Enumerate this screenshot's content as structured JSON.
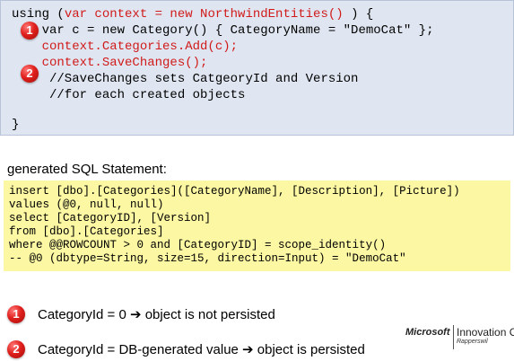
{
  "code": {
    "lines": [
      {
        "parts": [
          "using (",
          "var context = new NorthwindEntities()",
          " ) {"
        ]
      },
      {
        "parts": [
          "    var c = new Category() { CategoryName = \"DemoCat\" };"
        ]
      },
      {
        "parts": [
          "    context.Categories.Add(c);"
        ]
      },
      {
        "parts": [
          "    context.SaveChanges();"
        ]
      },
      {
        "parts": [
          "     //SaveChanges sets CatgeoryId and Version"
        ]
      },
      {
        "parts": [
          "     //for each created objects"
        ]
      },
      {
        "parts": [
          "}"
        ]
      }
    ],
    "markers": [
      "1",
      "2"
    ]
  },
  "sql": {
    "heading": "generated SQL Statement:",
    "lines": [
      "insert [dbo].[Categories]([CategoryName], [Description], [Picture])",
      "values (@0, null, null)",
      "select [CategoryID], [Version]",
      "from [dbo].[Categories]",
      "where @@ROWCOUNT > 0 and [CategoryID] = scope_identity()",
      "-- @0 (dbtype=String, size=15, direction=Input) = \"DemoCat\""
    ]
  },
  "legend": [
    {
      "marker": "1",
      "text": "CategoryId = 0 ➔ object is not persisted"
    },
    {
      "marker": "2",
      "text": "CategoryId = DB-generated value ➔ object is persisted"
    }
  ],
  "logo": {
    "brand": "Microsoft",
    "title": "Innovation C",
    "subtitle": "Rapperswil"
  },
  "colors": {
    "code_background": "#dfe6f1",
    "code_highlight": "#d11a1a",
    "sql_background": "#fbf7a2",
    "marker": "#e0201c"
  }
}
